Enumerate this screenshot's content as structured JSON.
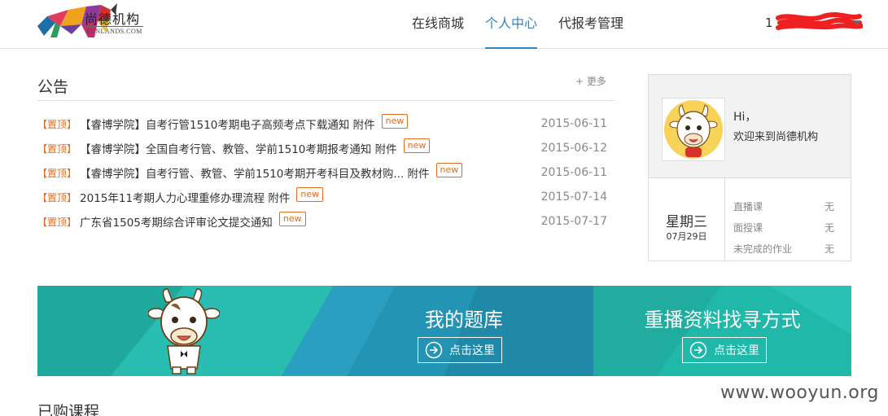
{
  "header": {
    "logo_title": "尚德机构",
    "logo_subtitle": "SUNLANDS.COM",
    "nav": [
      "在线商城",
      "个人中心",
      "代报考管理"
    ],
    "nav_active": 1,
    "user_visible": "1",
    "user_tail": "1"
  },
  "notice": {
    "title": "公告",
    "more": "+ 更多",
    "items": [
      {
        "pin": "【置顶】",
        "text": "【睿博学院】自考行管1510考期电子高频考点下载通知 附件",
        "badge": "new",
        "date": "2015-06-11"
      },
      {
        "pin": "【置顶】",
        "text": "【睿博学院】全国自考行管、教管、学前1510考期报考通知 附件",
        "badge": "new",
        "date": "2015-06-12"
      },
      {
        "pin": "【置顶】",
        "text": "【睿博学院】自考行管、教管、学前1510考期开考科目及教材购... 附件",
        "badge": "new",
        "date": "2015-06-11"
      },
      {
        "pin": "【置顶】",
        "text": "2015年11考期人力心理重修办理流程 附件",
        "badge": "new",
        "date": "2015-07-14"
      },
      {
        "pin": "【置顶】",
        "text": "广东省1505考期综合评审论文提交通知",
        "badge": "new",
        "date": "2015-07-17"
      }
    ]
  },
  "profile": {
    "greeting": "Hi，",
    "welcome": "欢迎来到尚德机构",
    "weekday": "星期三",
    "date": "07月29日",
    "stats": [
      {
        "label": "直播课",
        "value": "无"
      },
      {
        "label": "面授课",
        "value": "无"
      },
      {
        "label": "未完成的作业",
        "value": "无"
      }
    ]
  },
  "banner": {
    "question_bank": "我的题库",
    "question_bank_btn": "点击这里",
    "replay": "重播资料找寻方式",
    "replay_btn": "点击这里"
  },
  "courses_title": "已购课程",
  "watermark": "www.wooyun.org",
  "colors": {
    "accent": "#2c87c3",
    "pin": "#e46c1f",
    "banner_teal": "#1fb3a8",
    "banner_blue": "#2494b4"
  }
}
